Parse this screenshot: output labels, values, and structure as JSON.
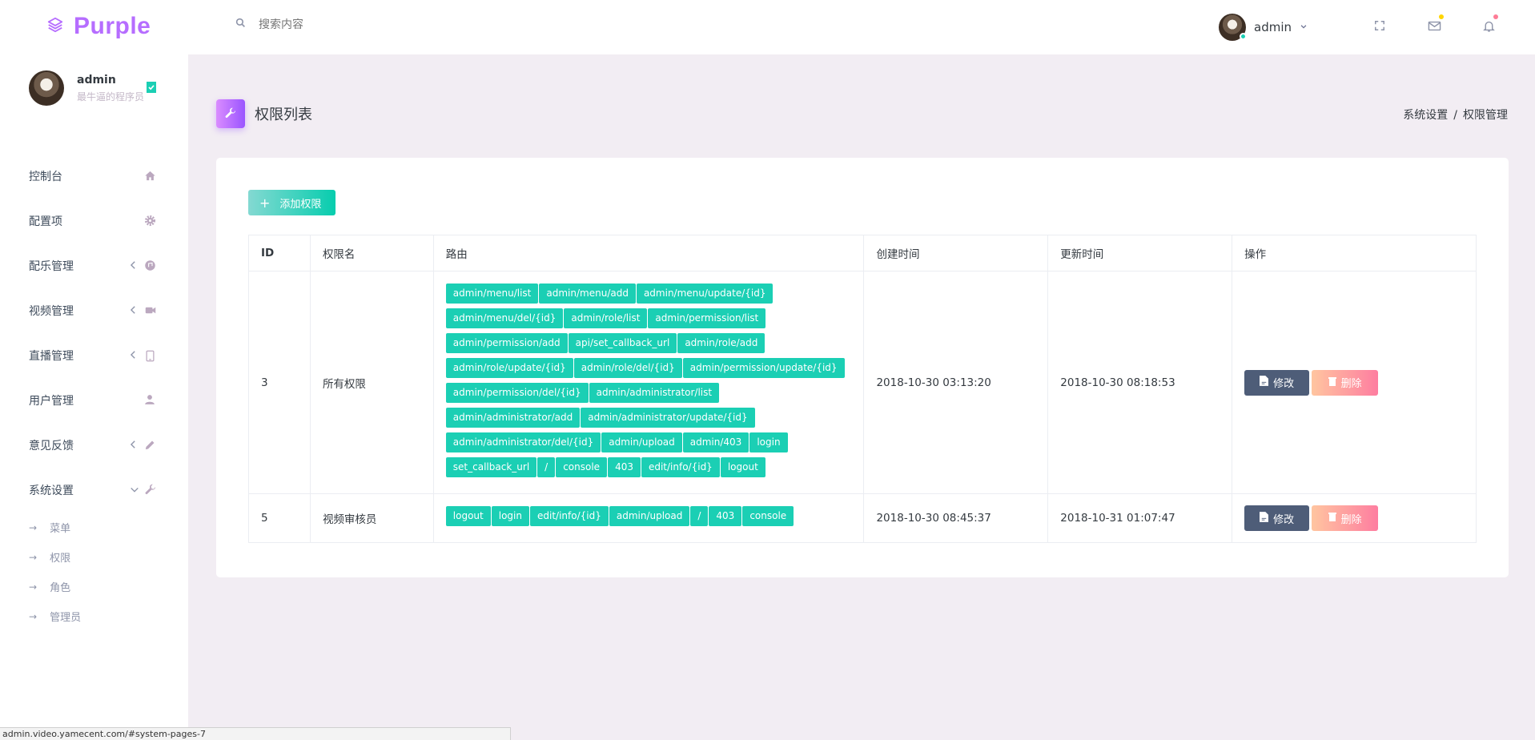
{
  "brand": {
    "name": "Purple"
  },
  "search": {
    "placeholder": "搜索内容"
  },
  "header": {
    "user": "admin",
    "colors": {
      "mail_badge": "#ffd500",
      "bell_badge": "#fe7c96"
    }
  },
  "sidebar": {
    "profile": {
      "name": "admin",
      "desc": "最牛逼的程序员"
    },
    "items": [
      {
        "label": "控制台",
        "icon": "home-icon",
        "expandable": false
      },
      {
        "label": "配置项",
        "icon": "gear-icon",
        "expandable": false
      },
      {
        "label": "配乐管理",
        "icon": "music-icon",
        "expandable": true
      },
      {
        "label": "视频管理",
        "icon": "video-icon",
        "expandable": true
      },
      {
        "label": "直播管理",
        "icon": "tablet-icon",
        "expandable": true
      },
      {
        "label": "用户管理",
        "icon": "user-icon",
        "expandable": false
      },
      {
        "label": "意见反馈",
        "icon": "pencil-icon",
        "expandable": true
      },
      {
        "label": "系统设置",
        "icon": "wrench-icon",
        "expandable": true,
        "expanded": true
      }
    ],
    "submenu": [
      "菜单",
      "权限",
      "角色",
      "管理员"
    ]
  },
  "page": {
    "title": "权限列表",
    "breadcrumb": [
      "系统设置",
      "权限管理"
    ],
    "add_button": "添加权限"
  },
  "table": {
    "headers": [
      "ID",
      "权限名",
      "路由",
      "创建时间",
      "更新时间",
      "操作"
    ],
    "rows": [
      {
        "id": "3",
        "name": "所有权限",
        "routes": [
          "admin/menu/list",
          "admin/menu/add",
          "admin/menu/update/{id}",
          "admin/menu/del/{id}",
          "admin/role/list",
          "admin/permission/list",
          "admin/permission/add",
          "api/set_callback_url",
          "admin/role/add",
          "admin/role/update/{id}",
          "admin/role/del/{id}",
          "admin/permission/update/{id}",
          "admin/permission/del/{id}",
          "admin/administrator/list",
          "admin/administrator/add",
          "admin/administrator/update/{id}",
          "admin/administrator/del/{id}",
          "admin/upload",
          "admin/403",
          "login",
          "set_callback_url",
          "/",
          "console",
          "403",
          "edit/info/{id}",
          "logout"
        ],
        "created": "2018-10-30 03:13:20",
        "updated": "2018-10-30 08:18:53"
      },
      {
        "id": "5",
        "name": "视频审核员",
        "routes": [
          "logout",
          "login",
          "edit/info/{id}",
          "admin/upload",
          "/",
          "403",
          "console"
        ],
        "created": "2018-10-30 08:45:37",
        "updated": "2018-10-31 01:07:47"
      }
    ],
    "edit_label": "修改",
    "delete_label": "删除"
  },
  "statusbar": {
    "url": "admin.video.yamecent.com/#system-pages-7"
  }
}
